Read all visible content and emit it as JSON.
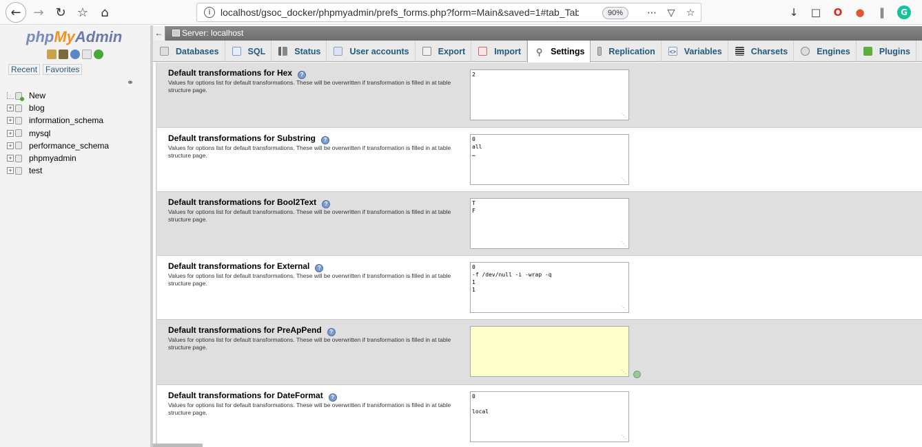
{
  "browser": {
    "url": "localhost/gsoc_docker/phpmyadmin/prefs_forms.php?form=Main&saved=1#tab_Tab",
    "zoom": "90%"
  },
  "nav": {
    "logo_php": "php",
    "logo_my": "My",
    "logo_admin": "Admin",
    "recent_label": "Recent",
    "favorites_label": "Favorites",
    "tree": [
      {
        "label": "New",
        "type": "new"
      },
      {
        "label": "blog",
        "type": "db"
      },
      {
        "label": "information_schema",
        "type": "db"
      },
      {
        "label": "mysql",
        "type": "db"
      },
      {
        "label": "performance_schema",
        "type": "db"
      },
      {
        "label": "phpmyadmin",
        "type": "db"
      },
      {
        "label": "test",
        "type": "db"
      }
    ]
  },
  "server": {
    "label": "Server: localhost"
  },
  "tabs": [
    {
      "label": "Databases",
      "icon": "database-icon",
      "active": false
    },
    {
      "label": "SQL",
      "icon": "sql-icon",
      "active": false
    },
    {
      "label": "Status",
      "icon": "status-icon",
      "active": false
    },
    {
      "label": "User accounts",
      "icon": "user-accounts-icon",
      "active": false
    },
    {
      "label": "Export",
      "icon": "export-icon",
      "active": false
    },
    {
      "label": "Import",
      "icon": "import-icon",
      "active": false
    },
    {
      "label": "Settings",
      "icon": "wrench-icon",
      "active": true
    },
    {
      "label": "Replication",
      "icon": "replication-icon",
      "active": false
    },
    {
      "label": "Variables",
      "icon": "variables-icon",
      "active": false
    },
    {
      "label": "Charsets",
      "icon": "charsets-icon",
      "active": false
    },
    {
      "label": "Engines",
      "icon": "engines-icon",
      "active": false
    },
    {
      "label": "Plugins",
      "icon": "plugins-icon",
      "active": false
    }
  ],
  "settings": {
    "description": "Values for options list for default transformations. These will be overwritten if transformation is filled in at table structure page.",
    "rows": [
      {
        "title": "Default transformations for Hex",
        "value": "2"
      },
      {
        "title": "Default transformations for Substring",
        "value": "0\nall\n…"
      },
      {
        "title": "Default transformations for Bool2Text",
        "value": "T\nF"
      },
      {
        "title": "Default transformations for External",
        "value": "0\n-f /dev/null -i -wrap -q\n1\n1"
      },
      {
        "title": "Default transformations for PreApPend",
        "value": ""
      },
      {
        "title": "Default transformations for DateFormat",
        "value": "0\n\nlocal"
      }
    ]
  },
  "colors": {
    "link": "#235a81",
    "row_shade": "#dfdfdf",
    "highlight_input": "#ffffcc"
  }
}
